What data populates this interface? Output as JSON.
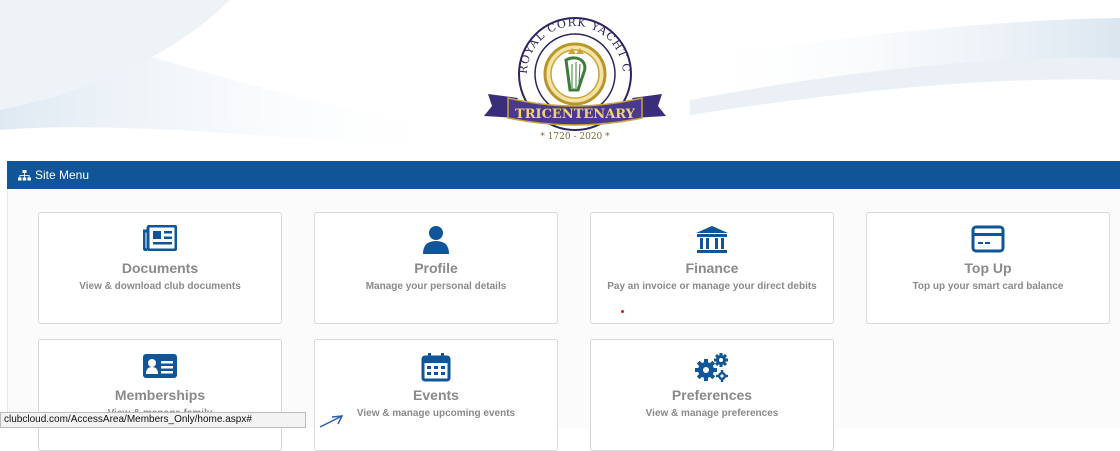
{
  "banner": {
    "club_name": "ROYAL CORK YACHT CLUB",
    "ribbon": "TRICENTENARY",
    "years": "* 1720 - 2020 *"
  },
  "menu": {
    "title": "Site Menu",
    "icon": "sitemap-icon"
  },
  "cards": [
    {
      "title": "Documents",
      "desc": "View & download club documents",
      "icon": "newspaper-icon"
    },
    {
      "title": "Profile",
      "desc": "Manage your personal details",
      "icon": "user-icon"
    },
    {
      "title": "Finance",
      "desc": "Pay an invoice or manage your direct debits",
      "icon": "bank-icon"
    },
    {
      "title": "Top Up",
      "desc": "Top up your smart card balance",
      "icon": "credit-card-icon"
    },
    {
      "title": "Memberships",
      "desc": "View & manage family",
      "icon": "id-card-icon"
    },
    {
      "title": "Events",
      "desc": "View & manage upcoming events",
      "icon": "calendar-icon"
    },
    {
      "title": "Preferences",
      "desc": "View & manage preferences",
      "icon": "cogs-icon"
    }
  ],
  "colors": {
    "menu_bar": "#0f5597",
    "icon": "#0f5597",
    "card_text": "#8a8a8a"
  },
  "status_url": "clubcloud.com/AccessArea/Members_Only/home.aspx#"
}
